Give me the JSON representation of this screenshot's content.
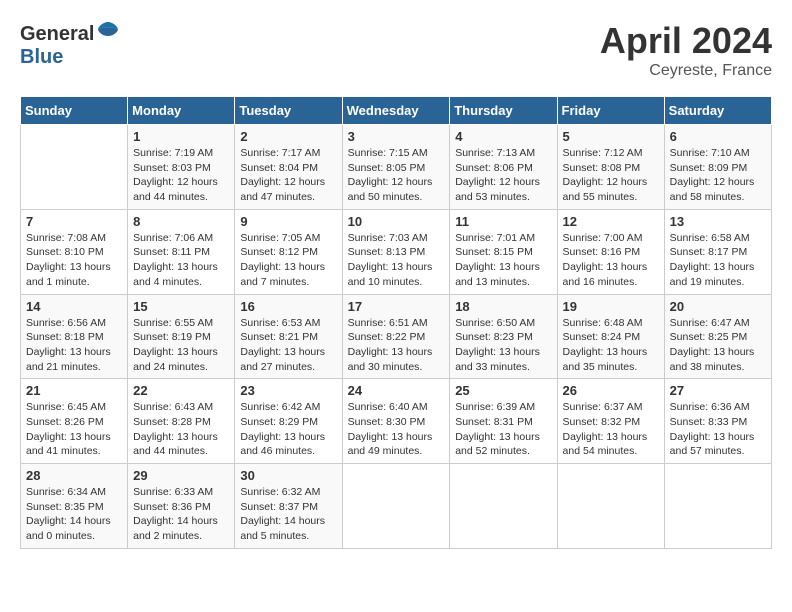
{
  "header": {
    "logo_general": "General",
    "logo_blue": "Blue",
    "month": "April 2024",
    "location": "Ceyreste, France"
  },
  "days_of_week": [
    "Sunday",
    "Monday",
    "Tuesday",
    "Wednesday",
    "Thursday",
    "Friday",
    "Saturday"
  ],
  "weeks": [
    [
      {
        "num": "",
        "info": ""
      },
      {
        "num": "1",
        "info": "Sunrise: 7:19 AM\nSunset: 8:03 PM\nDaylight: 12 hours\nand 44 minutes."
      },
      {
        "num": "2",
        "info": "Sunrise: 7:17 AM\nSunset: 8:04 PM\nDaylight: 12 hours\nand 47 minutes."
      },
      {
        "num": "3",
        "info": "Sunrise: 7:15 AM\nSunset: 8:05 PM\nDaylight: 12 hours\nand 50 minutes."
      },
      {
        "num": "4",
        "info": "Sunrise: 7:13 AM\nSunset: 8:06 PM\nDaylight: 12 hours\nand 53 minutes."
      },
      {
        "num": "5",
        "info": "Sunrise: 7:12 AM\nSunset: 8:08 PM\nDaylight: 12 hours\nand 55 minutes."
      },
      {
        "num": "6",
        "info": "Sunrise: 7:10 AM\nSunset: 8:09 PM\nDaylight: 12 hours\nand 58 minutes."
      }
    ],
    [
      {
        "num": "7",
        "info": "Sunrise: 7:08 AM\nSunset: 8:10 PM\nDaylight: 13 hours\nand 1 minute."
      },
      {
        "num": "8",
        "info": "Sunrise: 7:06 AM\nSunset: 8:11 PM\nDaylight: 13 hours\nand 4 minutes."
      },
      {
        "num": "9",
        "info": "Sunrise: 7:05 AM\nSunset: 8:12 PM\nDaylight: 13 hours\nand 7 minutes."
      },
      {
        "num": "10",
        "info": "Sunrise: 7:03 AM\nSunset: 8:13 PM\nDaylight: 13 hours\nand 10 minutes."
      },
      {
        "num": "11",
        "info": "Sunrise: 7:01 AM\nSunset: 8:15 PM\nDaylight: 13 hours\nand 13 minutes."
      },
      {
        "num": "12",
        "info": "Sunrise: 7:00 AM\nSunset: 8:16 PM\nDaylight: 13 hours\nand 16 minutes."
      },
      {
        "num": "13",
        "info": "Sunrise: 6:58 AM\nSunset: 8:17 PM\nDaylight: 13 hours\nand 19 minutes."
      }
    ],
    [
      {
        "num": "14",
        "info": "Sunrise: 6:56 AM\nSunset: 8:18 PM\nDaylight: 13 hours\nand 21 minutes."
      },
      {
        "num": "15",
        "info": "Sunrise: 6:55 AM\nSunset: 8:19 PM\nDaylight: 13 hours\nand 24 minutes."
      },
      {
        "num": "16",
        "info": "Sunrise: 6:53 AM\nSunset: 8:21 PM\nDaylight: 13 hours\nand 27 minutes."
      },
      {
        "num": "17",
        "info": "Sunrise: 6:51 AM\nSunset: 8:22 PM\nDaylight: 13 hours\nand 30 minutes."
      },
      {
        "num": "18",
        "info": "Sunrise: 6:50 AM\nSunset: 8:23 PM\nDaylight: 13 hours\nand 33 minutes."
      },
      {
        "num": "19",
        "info": "Sunrise: 6:48 AM\nSunset: 8:24 PM\nDaylight: 13 hours\nand 35 minutes."
      },
      {
        "num": "20",
        "info": "Sunrise: 6:47 AM\nSunset: 8:25 PM\nDaylight: 13 hours\nand 38 minutes."
      }
    ],
    [
      {
        "num": "21",
        "info": "Sunrise: 6:45 AM\nSunset: 8:26 PM\nDaylight: 13 hours\nand 41 minutes."
      },
      {
        "num": "22",
        "info": "Sunrise: 6:43 AM\nSunset: 8:28 PM\nDaylight: 13 hours\nand 44 minutes."
      },
      {
        "num": "23",
        "info": "Sunrise: 6:42 AM\nSunset: 8:29 PM\nDaylight: 13 hours\nand 46 minutes."
      },
      {
        "num": "24",
        "info": "Sunrise: 6:40 AM\nSunset: 8:30 PM\nDaylight: 13 hours\nand 49 minutes."
      },
      {
        "num": "25",
        "info": "Sunrise: 6:39 AM\nSunset: 8:31 PM\nDaylight: 13 hours\nand 52 minutes."
      },
      {
        "num": "26",
        "info": "Sunrise: 6:37 AM\nSunset: 8:32 PM\nDaylight: 13 hours\nand 54 minutes."
      },
      {
        "num": "27",
        "info": "Sunrise: 6:36 AM\nSunset: 8:33 PM\nDaylight: 13 hours\nand 57 minutes."
      }
    ],
    [
      {
        "num": "28",
        "info": "Sunrise: 6:34 AM\nSunset: 8:35 PM\nDaylight: 14 hours\nand 0 minutes."
      },
      {
        "num": "29",
        "info": "Sunrise: 6:33 AM\nSunset: 8:36 PM\nDaylight: 14 hours\nand 2 minutes."
      },
      {
        "num": "30",
        "info": "Sunrise: 6:32 AM\nSunset: 8:37 PM\nDaylight: 14 hours\nand 5 minutes."
      },
      {
        "num": "",
        "info": ""
      },
      {
        "num": "",
        "info": ""
      },
      {
        "num": "",
        "info": ""
      },
      {
        "num": "",
        "info": ""
      }
    ]
  ]
}
